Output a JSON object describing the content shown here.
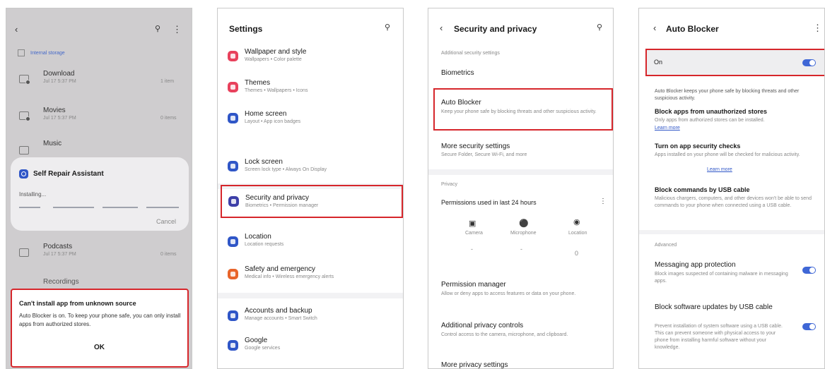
{
  "colors": {
    "accent": "#3f67d6",
    "highlight_border": "#d6262b"
  },
  "my_files": {
    "back_icon": "back-arrow-icon",
    "breadcrumb": "Internal storage",
    "items": [
      {
        "name": "Download",
        "date": "Jul 17 5:37 PM",
        "meta": "1 item"
      },
      {
        "name": "Movies",
        "date": "Jul 17 5:37 PM",
        "meta": "0 items"
      },
      {
        "name": "Music",
        "date": "",
        "meta": ""
      },
      {
        "name": "Podcasts",
        "date": "Jul 17 5:37 PM",
        "meta": "0 items"
      },
      {
        "name": "Recordings",
        "date": "",
        "meta": ""
      }
    ],
    "overlay": {
      "title": "Self Repair Assistant",
      "status": "Installing...",
      "cancel": "Cancel"
    },
    "dialog": {
      "title": "Can't install app from unknown source",
      "body": "Auto Blocker is on. To keep your phone safe, you can only install apps from authorized stores.",
      "ok": "OK"
    }
  },
  "settings": {
    "title": "Settings",
    "items": [
      {
        "label": "Wallpaper and style",
        "sub": "Wallpapers  •  Color palette",
        "color": "#e8415c"
      },
      {
        "label": "Themes",
        "sub": "Themes  •  Wallpapers  •  Icons",
        "color": "#e8415c"
      },
      {
        "label": "Home screen",
        "sub": "Layout  •  App icon badges",
        "color": "#2f56c7"
      },
      {
        "label": "Lock screen",
        "sub": "Screen lock type  •  Always On Display",
        "color": "#2f56c7"
      },
      {
        "label": "Security and privacy",
        "sub": "Biometrics  •  Permission manager",
        "color": "#3d3fa8"
      },
      {
        "label": "Location",
        "sub": "Location requests",
        "color": "#2f56c7"
      },
      {
        "label": "Safety and emergency",
        "sub": "Medical info  •  Wireless emergency alerts",
        "color": "#e8642a"
      },
      {
        "label": "Accounts and backup",
        "sub": "Manage accounts  •  Smart Switch",
        "color": "#2f56c7"
      },
      {
        "label": "Google",
        "sub": "Google services",
        "color": "#2f56c7"
      }
    ]
  },
  "security": {
    "title": "Security and privacy",
    "section_top": "Additional security settings",
    "biometrics": "Biometrics",
    "auto_blocker": {
      "label": "Auto Blocker",
      "sub": "Keep your phone safe by blocking threats and other suspicious activity."
    },
    "more_security": {
      "label": "More security settings",
      "sub": "Secure Folder, Secure Wi-Fi, and more"
    },
    "privacy_header": "Privacy",
    "permissions_used": "Permissions used in last 24 hours",
    "perm_items": [
      {
        "label": "Camera",
        "count": "-"
      },
      {
        "label": "Microphone",
        "count": "-"
      },
      {
        "label": "Location",
        "count": "0"
      }
    ],
    "permission_manager": {
      "label": "Permission manager",
      "sub": "Allow or deny apps to access features or data on your phone."
    },
    "additional_privacy": {
      "label": "Additional privacy controls",
      "sub": "Control access to the camera, microphone, and clipboard."
    },
    "more_privacy": "More privacy settings"
  },
  "auto_blocker": {
    "title": "Auto Blocker",
    "on_label": "On",
    "intro": "Auto Blocker keeps your phone safe by blocking threats and other suspicious activity.",
    "block_stores": {
      "label": "Block apps from unauthorized stores",
      "sub": "Only apps from authorized stores can be installed.",
      "link": "Learn more"
    },
    "app_checks": {
      "label": "Turn on app security checks",
      "sub": "Apps installed on your phone will be checked for malicious activity.",
      "link": "Learn more"
    },
    "usb_commands": {
      "label": "Block commands by USB cable",
      "sub": "Malicious chargers, computers, and other devices won't be able to send commands to your phone when connected using a USB cable."
    },
    "advanced_header": "Advanced",
    "messaging": {
      "label": "Messaging app protection",
      "sub": "Block images suspected of containing malware in messaging apps."
    },
    "usb_updates": {
      "label": "Block software updates by USB cable",
      "sub": "Prevent installation of system software using a USB cable. This can prevent someone with physical access to your phone from installing harmful software without your knowledge."
    }
  }
}
